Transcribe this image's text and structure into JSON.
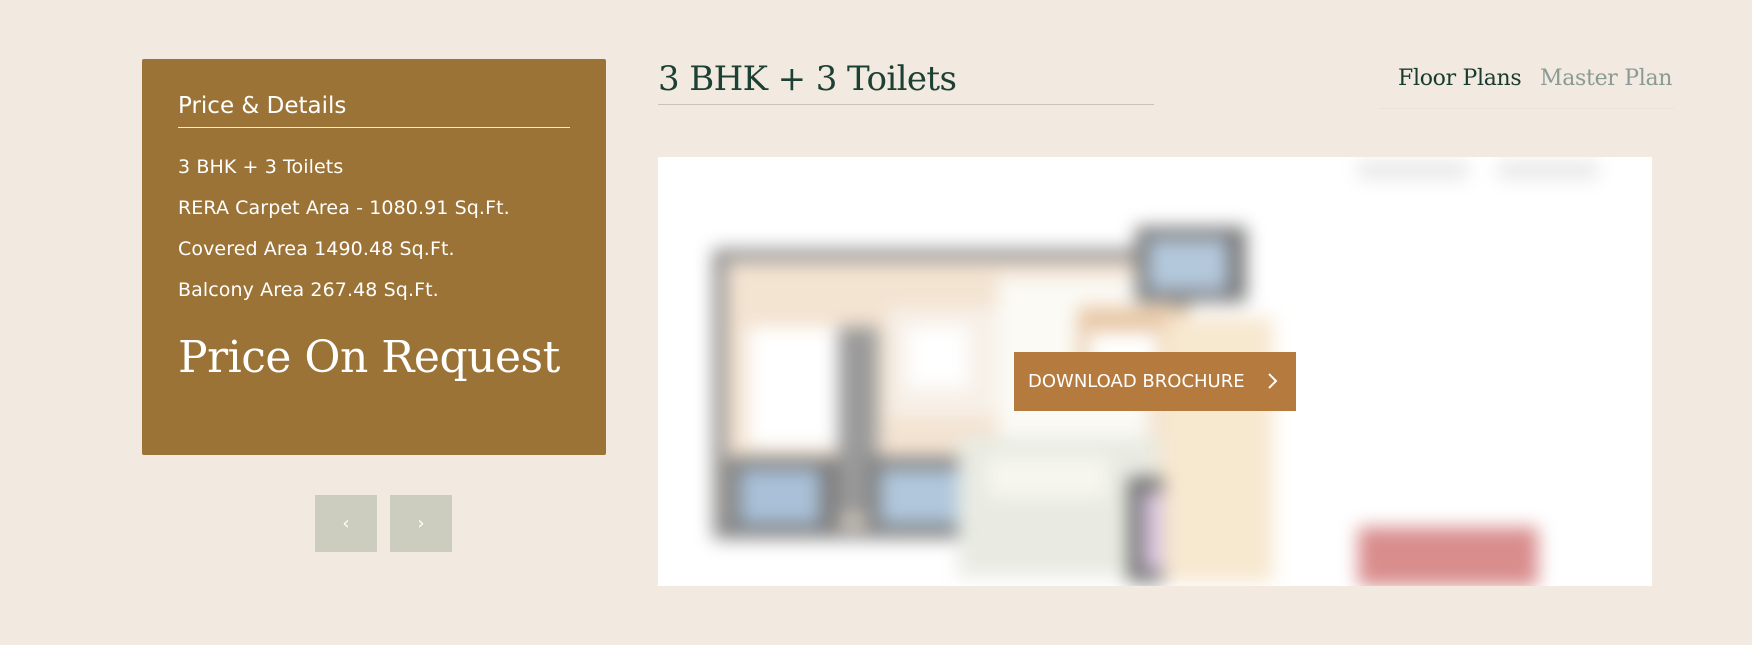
{
  "details": {
    "title": "Price & Details",
    "items": [
      "3 BHK + 3 Toilets",
      "RERA Carpet Area - 1080.91 Sq.Ft.",
      "Covered Area 1490.48 Sq.Ft.",
      "Balcony Area 267.48 Sq.Ft."
    ],
    "price": "Price On Request"
  },
  "pager": {
    "prev": "‹",
    "next": "›"
  },
  "plan": {
    "title": "3 BHK + 3 Toilets",
    "download_label": "DOWNLOAD BROCHURE"
  },
  "tabs": {
    "floor_plans": "Floor Plans",
    "master_plan": "Master Plan"
  },
  "colors": {
    "background": "#f2e9e0",
    "card": "#9b7337",
    "accent_button": "#b57a3e",
    "heading_green": "#1c4034",
    "inactive_tab": "#8a9a94",
    "pager": "#cccdbf"
  }
}
